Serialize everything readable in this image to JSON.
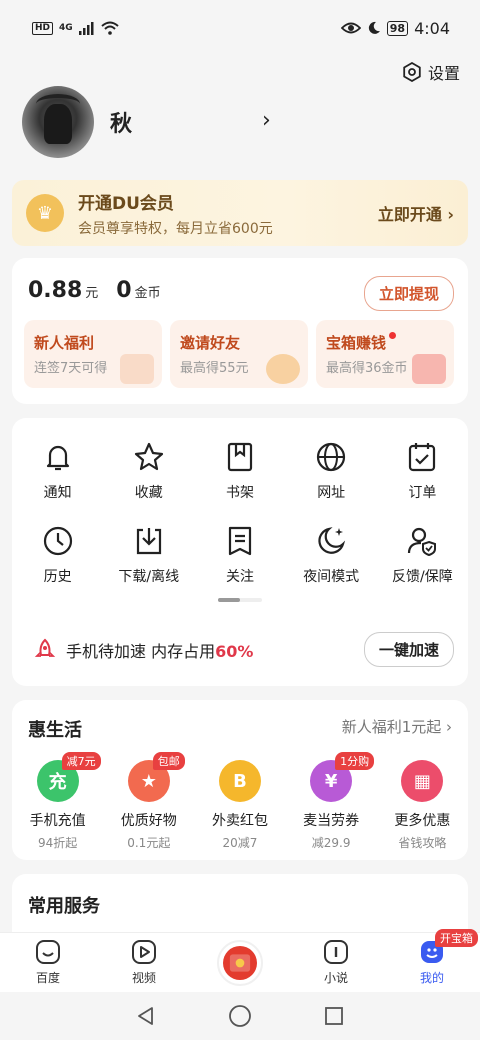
{
  "status_bar": {
    "hd": "HD",
    "network": "4G",
    "battery": "98",
    "time": "4:04"
  },
  "settings": {
    "label": "设置"
  },
  "profile": {
    "name": "秋"
  },
  "vip": {
    "title": "开通DU会员",
    "subtitle": "会员尊享特权，每月立省600元",
    "button": "立即开通 ›"
  },
  "wallet": {
    "money": "0.88",
    "money_unit": "元",
    "gold": "0",
    "gold_unit": "金币",
    "withdraw": "立即提现",
    "tiles": [
      {
        "title": "新人福利",
        "sub": "连签7天可得"
      },
      {
        "title": "邀请好友",
        "sub": "最高得55元"
      },
      {
        "title": "宝箱赚钱",
        "sub": "最高得36金币"
      }
    ]
  },
  "features": {
    "items": [
      {
        "label": "通知",
        "icon": "bell-icon"
      },
      {
        "label": "收藏",
        "icon": "star-icon"
      },
      {
        "label": "书架",
        "icon": "bookmark-icon"
      },
      {
        "label": "网址",
        "icon": "globe-icon"
      },
      {
        "label": "订单",
        "icon": "clipboard-check-icon"
      },
      {
        "label": "历史",
        "icon": "clock-icon"
      },
      {
        "label": "下载/离线",
        "icon": "download-icon"
      },
      {
        "label": "关注",
        "icon": "document-list-icon"
      },
      {
        "label": "夜间模式",
        "icon": "moon-icon"
      },
      {
        "label": "反馈/保障",
        "icon": "user-shield-icon"
      }
    ],
    "boost_text": "手机待加速 内存占用",
    "boost_pct": "60%",
    "boost_button": "一键加速"
  },
  "life": {
    "title": "惠生活",
    "more": "新人福利1元起 ›",
    "items": [
      {
        "name": "手机充值",
        "desc": "94折起",
        "badge": "减7元",
        "color": "#3cc46b",
        "glyph": "充"
      },
      {
        "name": "优质好物",
        "desc": "0.1元起",
        "badge": "包邮",
        "color": "#f26a4f",
        "glyph": "★"
      },
      {
        "name": "外卖红包",
        "desc": "20减7",
        "badge": "",
        "color": "#f5b72c",
        "glyph": "B"
      },
      {
        "name": "麦当劳券",
        "desc": "减29.9",
        "badge": "1分购",
        "color": "#b85ad6",
        "glyph": "¥"
      },
      {
        "name": "更多优惠",
        "desc": "省钱攻略",
        "badge": "",
        "color": "#ec4d6b",
        "glyph": "▦"
      }
    ]
  },
  "common": {
    "title": "常用服务"
  },
  "tabbar": {
    "items": [
      {
        "label": "百度"
      },
      {
        "label": "视频"
      },
      {
        "label": ""
      },
      {
        "label": "小说"
      },
      {
        "label": "我的",
        "badge": "开宝箱"
      }
    ]
  }
}
